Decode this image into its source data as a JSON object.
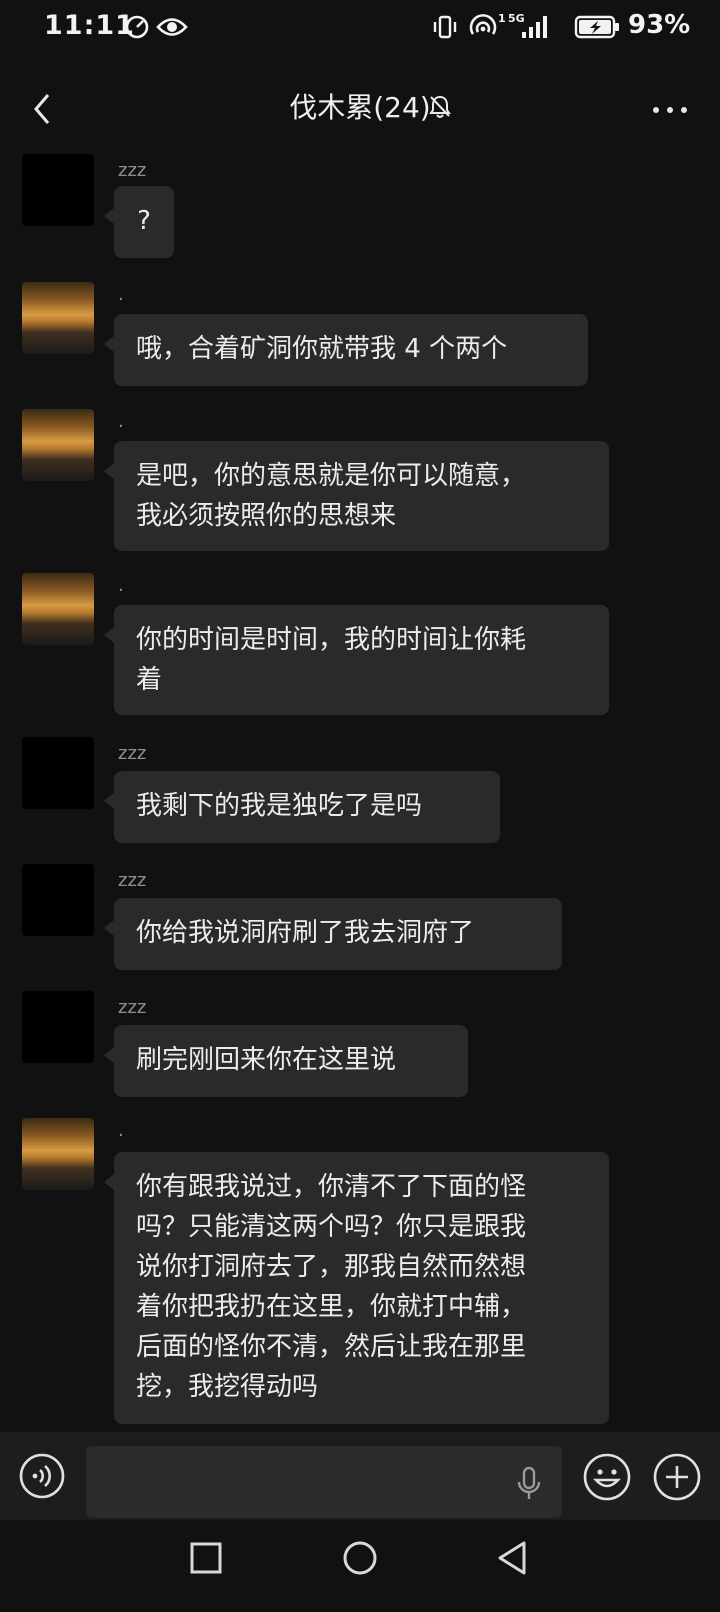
{
  "status": {
    "time": "11:11",
    "network": "5G",
    "sim": "1",
    "battery": "93%"
  },
  "header": {
    "title": "伐木累(24)"
  },
  "messages": [
    {
      "sender": "zzz",
      "avatar": "black-avatar",
      "text": "?"
    },
    {
      "sender": ".",
      "avatar": "sunset-avatar",
      "text": "哦，合着矿洞你就带我 4 个两个"
    },
    {
      "sender": ".",
      "avatar": "sunset-avatar",
      "lines": [
        "是吧，你的意思就是你可以随意，",
        "我必须按照你的思想来"
      ]
    },
    {
      "sender": ".",
      "avatar": "sunset-avatar",
      "lines": [
        "你的时间是时间，我的时间让你耗",
        "着"
      ]
    },
    {
      "sender": "zzz",
      "avatar": "black-avatar",
      "text": "我剩下的我是独吃了是吗"
    },
    {
      "sender": "zzz",
      "avatar": "black-avatar",
      "text": "你给我说洞府刷了我去洞府了"
    },
    {
      "sender": "zzz",
      "avatar": "black-avatar",
      "text": "刷完刚回来你在这里说"
    },
    {
      "sender": ".",
      "avatar": "sunset-avatar",
      "lines": [
        "你有跟我说过，你清不了下面的怪",
        "吗？只能清这两个吗？你只是跟我",
        "说你打洞府去了，那我自然而然想",
        "着你把我扔在这里，你就打中辅，",
        "后面的怪你不清，然后让我在那里",
        "挖，我挖得动吗"
      ]
    }
  ],
  "input": {
    "value": "",
    "voice_icon": "voice-icon",
    "mic_icon": "microphone-icon",
    "emoji_icon": "emoji-icon",
    "plus_icon": "plus-icon"
  },
  "nav": {
    "recent_icon": "square-icon",
    "home_icon": "circle-icon",
    "back_icon": "triangle-back-icon"
  }
}
